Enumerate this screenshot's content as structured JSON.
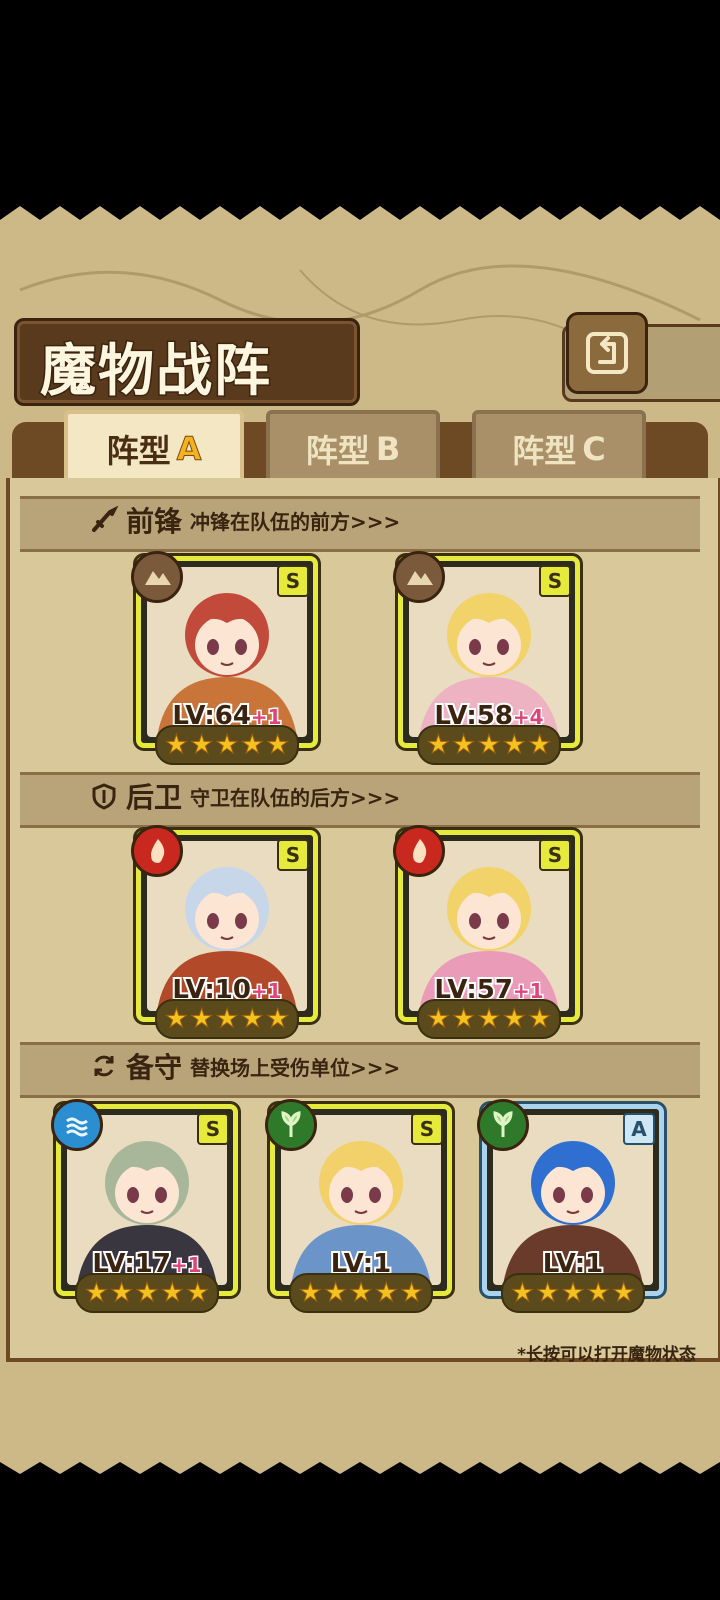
{
  "title": "魔物战阵",
  "tabs": [
    {
      "prefix": "阵型",
      "suffix": "A",
      "active": true
    },
    {
      "prefix": "阵型",
      "suffix": "B",
      "active": false
    },
    {
      "prefix": "阵型",
      "suffix": "C",
      "active": false
    }
  ],
  "sections": [
    {
      "icon": "sword-icon",
      "title": "前锋",
      "desc": "冲锋在队伍的前方>>>"
    },
    {
      "icon": "shield-icon",
      "title": "后卫",
      "desc": "守卫在队伍的后方>>>"
    },
    {
      "icon": "swap-icon",
      "title": "备守",
      "desc": "替换场上受伤单位>>>"
    }
  ],
  "units": [
    {
      "section": 0,
      "element": "earth",
      "rank": "S",
      "lv": "LV:64",
      "bonus": "+1",
      "stars": 5,
      "hair": "#c24a3a",
      "outfit": "#c9753a"
    },
    {
      "section": 0,
      "element": "earth",
      "rank": "S",
      "lv": "LV:58",
      "bonus": "+4",
      "stars": 5,
      "hair": "#f2d36a",
      "outfit": "#eeb3c2"
    },
    {
      "section": 1,
      "element": "fire",
      "rank": "S",
      "lv": "LV:10",
      "bonus": "+1",
      "stars": 5,
      "hair": "#c8d6ea",
      "outfit": "#b24a2a"
    },
    {
      "section": 1,
      "element": "fire",
      "rank": "S",
      "lv": "LV:57",
      "bonus": "+1",
      "stars": 5,
      "hair": "#f2d36a",
      "outfit": "#e99bb8"
    },
    {
      "section": 2,
      "element": "water",
      "rank": "S",
      "lv": "LV:17",
      "bonus": "+1",
      "stars": 5,
      "hair": "#a8b79a",
      "outfit": "#3a3640"
    },
    {
      "section": 2,
      "element": "nature",
      "rank": "S",
      "lv": "LV:1",
      "bonus": "",
      "stars": 5,
      "hair": "#f2d06a",
      "outfit": "#6b94c9"
    },
    {
      "section": 2,
      "element": "nature",
      "rank": "A",
      "lv": "LV:1",
      "bonus": "",
      "stars": 5,
      "hair": "#2f6fd0",
      "outfit": "#6a3a2a"
    }
  ],
  "footnote": "*长按可以打开魔物状态",
  "colors": {
    "panel": "#cdb987",
    "frame": "#6d4a24",
    "card_border_s": "#e6ea3a",
    "card_border_a": "#aad4ee",
    "star": "#f4c21e",
    "bonus": "#e0457a"
  }
}
